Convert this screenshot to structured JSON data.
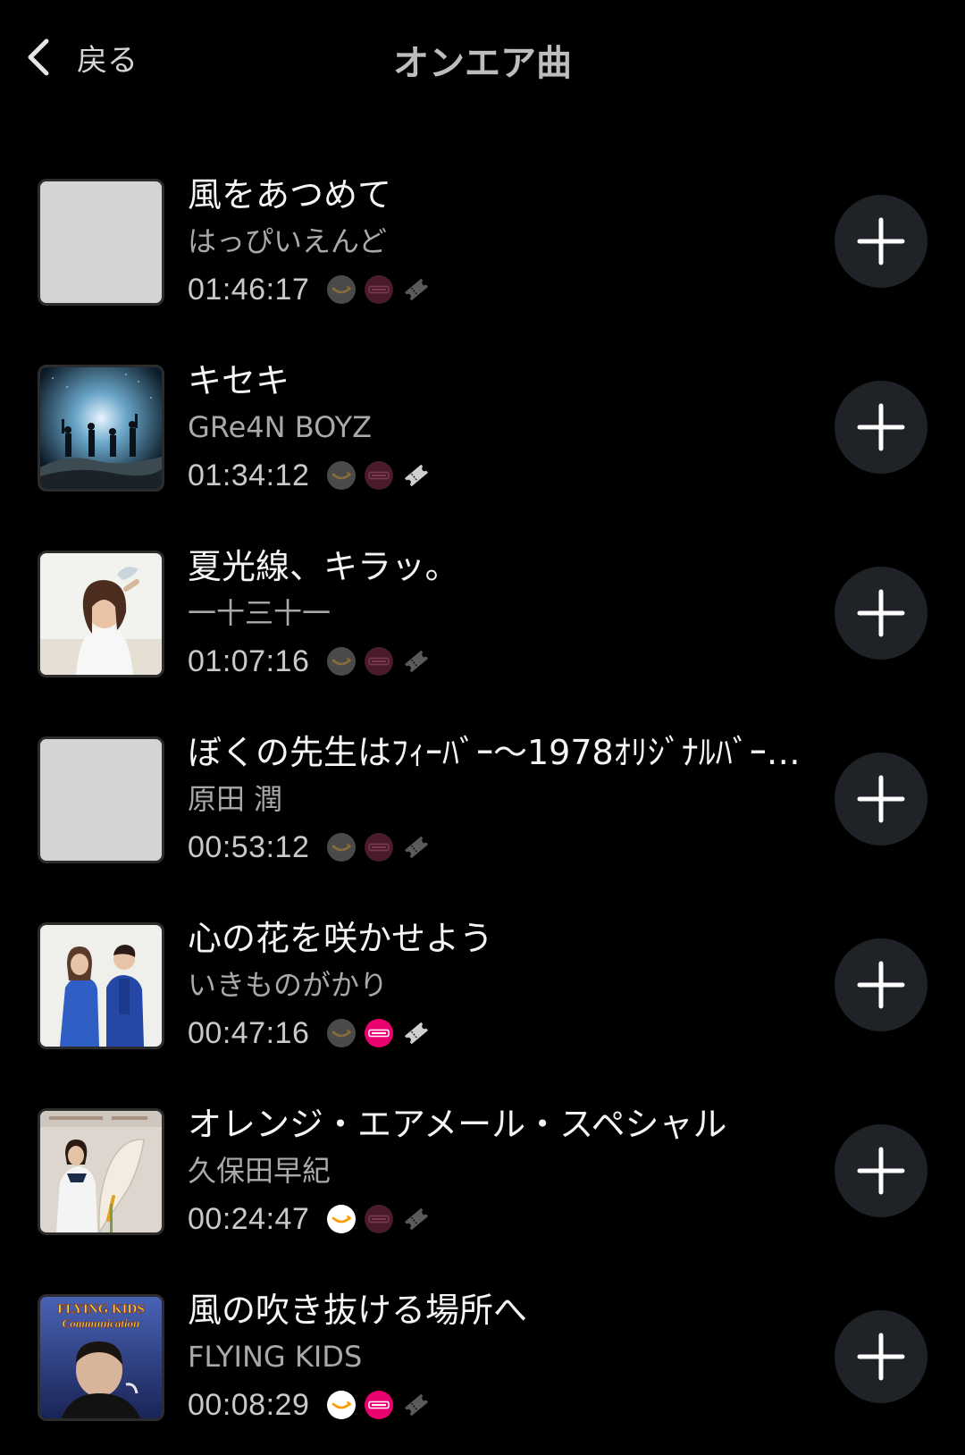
{
  "header": {
    "back_label": "戻る",
    "title": "オンエア曲"
  },
  "colors": {
    "background": "#000000",
    "amazon_active": "#ffffff",
    "amazon_inactive": "#4a4a4a",
    "recochoku_active": "#e8006f",
    "recochoku_inactive": "#4a1a2c",
    "ticket_active": "#cfcfcf",
    "ticket_inactive": "#5a5a5a",
    "add_button_bg": "#1f2226"
  },
  "songs": [
    {
      "title": "風をあつめて",
      "artist": "はっぴいえんど",
      "time": "01:46:17",
      "artwork": "placeholder",
      "amazon": "inactive",
      "recochoku": "inactive",
      "ticket": "inactive"
    },
    {
      "title": "キセキ",
      "artist": "GRe4N BOYZ",
      "time": "01:34:12",
      "artwork": "night-sky-silhouettes",
      "amazon": "inactive",
      "recochoku": "inactive",
      "ticket": "active"
    },
    {
      "title": "夏光線、キラッ。",
      "artist": "一十三十一",
      "time": "01:07:16",
      "artwork": "beach-portrait",
      "amazon": "inactive",
      "recochoku": "inactive",
      "ticket": "inactive"
    },
    {
      "title": "ぼくの先生はﾌｨｰﾊﾞｰ～1978ｵﾘｼﾞﾅﾙﾊﾞｰ…",
      "artist": "原田 潤",
      "time": "00:53:12",
      "artwork": "placeholder",
      "amazon": "inactive",
      "recochoku": "inactive",
      "ticket": "inactive"
    },
    {
      "title": "心の花を咲かせよう",
      "artist": "いきものがかり",
      "time": "00:47:16",
      "artwork": "duo-blue-outfits",
      "amazon": "inactive",
      "recochoku": "active",
      "ticket": "active"
    },
    {
      "title": "オレンジ・エアメール・スペシャル",
      "artist": "久保田早紀",
      "time": "00:24:47",
      "artwork": "calla-lily-portrait",
      "amazon": "active",
      "recochoku": "inactive",
      "ticket": "inactive"
    },
    {
      "title": "風の吹き抜ける場所へ",
      "artist": "FLYING KIDS",
      "time": "00:08:29",
      "artwork": "flying-kids-cover",
      "artwork_text": "FLYING KIDS",
      "artwork_subtext": "Communication",
      "amazon": "active",
      "recochoku": "active",
      "ticket": "inactive"
    }
  ]
}
